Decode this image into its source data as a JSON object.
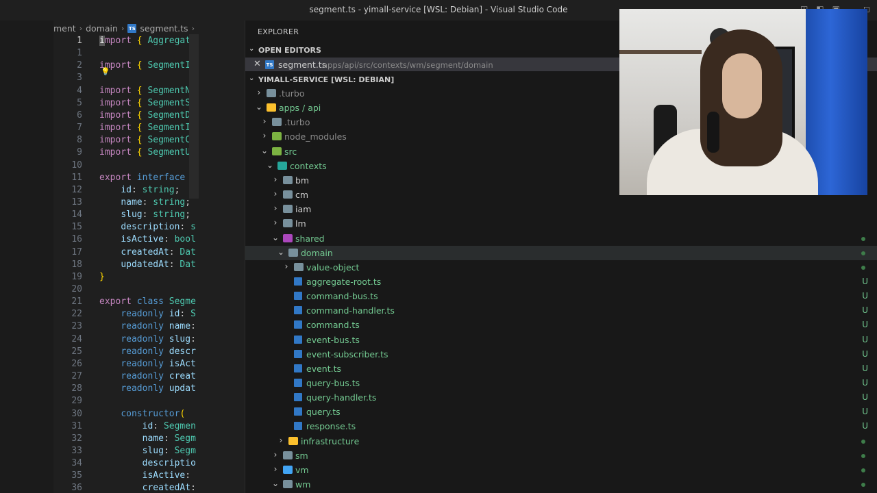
{
  "window": {
    "title": "segment.ts - yimall-service [WSL: Debian] - Visual Studio Code"
  },
  "editor": {
    "breadcrumb": [
      "ment",
      "domain",
      "segment.ts",
      "..."
    ],
    "lines": [
      {
        "n": "1",
        "tokens": [
          [
            "cursor",
            "i"
          ],
          [
            "kw",
            "mport "
          ],
          [
            "br",
            "{ "
          ],
          [
            "ty",
            "Aggregate"
          ]
        ]
      },
      {
        "n": "1",
        "tokens": []
      },
      {
        "n": "2",
        "tokens": [
          [
            "kw",
            "import "
          ],
          [
            "br",
            "{ "
          ],
          [
            "ty",
            "SegmentId"
          ]
        ]
      },
      {
        "n": "3",
        "tokens": []
      },
      {
        "n": "4",
        "tokens": [
          [
            "kw",
            "import "
          ],
          [
            "br",
            "{ "
          ],
          [
            "ty",
            "SegmentNa"
          ]
        ]
      },
      {
        "n": "5",
        "tokens": [
          [
            "kw",
            "import "
          ],
          [
            "br",
            "{ "
          ],
          [
            "ty",
            "SegmentSl"
          ]
        ]
      },
      {
        "n": "6",
        "tokens": [
          [
            "kw",
            "import "
          ],
          [
            "br",
            "{ "
          ],
          [
            "ty",
            "SegmentDe"
          ]
        ]
      },
      {
        "n": "7",
        "tokens": [
          [
            "kw",
            "import "
          ],
          [
            "br",
            "{ "
          ],
          [
            "ty",
            "SegmentIs"
          ]
        ]
      },
      {
        "n": "8",
        "tokens": [
          [
            "kw",
            "import "
          ],
          [
            "br",
            "{ "
          ],
          [
            "ty",
            "SegmentCr"
          ]
        ]
      },
      {
        "n": "9",
        "tokens": [
          [
            "kw",
            "import "
          ],
          [
            "br",
            "{ "
          ],
          [
            "ty",
            "SegmentUp"
          ]
        ]
      },
      {
        "n": "10",
        "tokens": []
      },
      {
        "n": "11",
        "tokens": [
          [
            "kw",
            "export "
          ],
          [
            "kw2",
            "interface "
          ],
          [
            "ty",
            "S"
          ]
        ]
      },
      {
        "n": "12",
        "tokens": [
          [
            "pun",
            "    "
          ],
          [
            "prop",
            "id"
          ],
          [
            "pun",
            ": "
          ],
          [
            "ty",
            "string"
          ],
          [
            "pun",
            ";"
          ]
        ]
      },
      {
        "n": "13",
        "tokens": [
          [
            "pun",
            "    "
          ],
          [
            "prop",
            "name"
          ],
          [
            "pun",
            ": "
          ],
          [
            "ty",
            "string"
          ],
          [
            "pun",
            ";"
          ]
        ]
      },
      {
        "n": "14",
        "tokens": [
          [
            "pun",
            "    "
          ],
          [
            "prop",
            "slug"
          ],
          [
            "pun",
            ": "
          ],
          [
            "ty",
            "string"
          ],
          [
            "pun",
            ";"
          ]
        ]
      },
      {
        "n": "15",
        "tokens": [
          [
            "pun",
            "    "
          ],
          [
            "prop",
            "description"
          ],
          [
            "pun",
            ": "
          ],
          [
            "ty",
            "s"
          ]
        ]
      },
      {
        "n": "16",
        "tokens": [
          [
            "pun",
            "    "
          ],
          [
            "prop",
            "isActive"
          ],
          [
            "pun",
            ": "
          ],
          [
            "ty",
            "bool"
          ]
        ]
      },
      {
        "n": "17",
        "tokens": [
          [
            "pun",
            "    "
          ],
          [
            "prop",
            "createdAt"
          ],
          [
            "pun",
            ": "
          ],
          [
            "ty",
            "Dat"
          ]
        ]
      },
      {
        "n": "18",
        "tokens": [
          [
            "pun",
            "    "
          ],
          [
            "prop",
            "updatedAt"
          ],
          [
            "pun",
            ": "
          ],
          [
            "ty",
            "Dat"
          ]
        ]
      },
      {
        "n": "19",
        "tokens": [
          [
            "br",
            "}"
          ]
        ]
      },
      {
        "n": "20",
        "tokens": []
      },
      {
        "n": "21",
        "tokens": [
          [
            "kw",
            "export "
          ],
          [
            "kw2",
            "class "
          ],
          [
            "ty",
            "Segme"
          ]
        ]
      },
      {
        "n": "22",
        "tokens": [
          [
            "pun",
            "    "
          ],
          [
            "kw2",
            "readonly "
          ],
          [
            "prop",
            "id"
          ],
          [
            "pun",
            ": "
          ],
          [
            "ty",
            "S"
          ]
        ]
      },
      {
        "n": "23",
        "tokens": [
          [
            "pun",
            "    "
          ],
          [
            "kw2",
            "readonly "
          ],
          [
            "prop",
            "name"
          ],
          [
            "pun",
            ":"
          ]
        ]
      },
      {
        "n": "24",
        "tokens": [
          [
            "pun",
            "    "
          ],
          [
            "kw2",
            "readonly "
          ],
          [
            "prop",
            "slug"
          ],
          [
            "pun",
            ":"
          ]
        ]
      },
      {
        "n": "25",
        "tokens": [
          [
            "pun",
            "    "
          ],
          [
            "kw2",
            "readonly "
          ],
          [
            "prop",
            "descr"
          ]
        ]
      },
      {
        "n": "26",
        "tokens": [
          [
            "pun",
            "    "
          ],
          [
            "kw2",
            "readonly "
          ],
          [
            "prop",
            "isAct"
          ]
        ]
      },
      {
        "n": "27",
        "tokens": [
          [
            "pun",
            "    "
          ],
          [
            "kw2",
            "readonly "
          ],
          [
            "prop",
            "creat"
          ]
        ]
      },
      {
        "n": "28",
        "tokens": [
          [
            "pun",
            "    "
          ],
          [
            "kw2",
            "readonly "
          ],
          [
            "prop",
            "updat"
          ]
        ]
      },
      {
        "n": "29",
        "tokens": []
      },
      {
        "n": "30",
        "tokens": [
          [
            "pun",
            "    "
          ],
          [
            "kw2",
            "constructor"
          ],
          [
            "br",
            "("
          ]
        ]
      },
      {
        "n": "31",
        "tokens": [
          [
            "pun",
            "        "
          ],
          [
            "prop",
            "id"
          ],
          [
            "pun",
            ": "
          ],
          [
            "ty",
            "Segmen"
          ]
        ]
      },
      {
        "n": "32",
        "tokens": [
          [
            "pun",
            "        "
          ],
          [
            "prop",
            "name"
          ],
          [
            "pun",
            ": "
          ],
          [
            "ty",
            "Segm"
          ]
        ]
      },
      {
        "n": "33",
        "tokens": [
          [
            "pun",
            "        "
          ],
          [
            "prop",
            "slug"
          ],
          [
            "pun",
            ": "
          ],
          [
            "ty",
            "Segm"
          ]
        ]
      },
      {
        "n": "34",
        "tokens": [
          [
            "pun",
            "        "
          ],
          [
            "prop",
            "descriptio"
          ]
        ]
      },
      {
        "n": "35",
        "tokens": [
          [
            "pun",
            "        "
          ],
          [
            "prop",
            "isActive"
          ],
          [
            "pun",
            ":"
          ]
        ]
      },
      {
        "n": "36",
        "tokens": [
          [
            "pun",
            "        "
          ],
          [
            "prop",
            "createdAt"
          ],
          [
            "pun",
            ":"
          ]
        ]
      }
    ]
  },
  "explorer": {
    "title": "EXPLORER",
    "open_editors_label": "OPEN EDITORS",
    "open_editor": {
      "name": "segment.ts",
      "path": "apps/api/src/contexts/wm/segment/domain"
    },
    "workspace_label": "YIMALL-SERVICE [WSL: DEBIAN]",
    "tree": [
      {
        "depth": 0,
        "type": "folder",
        "open": false,
        "name": ".turbo",
        "color": "gray2",
        "name_color": "#8b8b8b",
        "status": "",
        "dot": false
      },
      {
        "depth": 0,
        "type": "folder",
        "open": true,
        "name": "apps / api",
        "color": "yellow",
        "name_color": "#73c991",
        "status": "",
        "dot": true
      },
      {
        "depth": 1,
        "type": "folder",
        "open": false,
        "name": ".turbo",
        "color": "gray2",
        "name_color": "#8b8b8b",
        "status": "",
        "dot": false
      },
      {
        "depth": 1,
        "type": "folder",
        "open": false,
        "name": "node_modules",
        "color": "green",
        "name_color": "#8b8b8b",
        "status": "",
        "dot": false
      },
      {
        "depth": 1,
        "type": "folder",
        "open": true,
        "name": "src",
        "color": "green",
        "name_color": "#73c991",
        "status": "",
        "dot": true
      },
      {
        "depth": 2,
        "type": "folder",
        "open": true,
        "name": "contexts",
        "color": "teal",
        "name_color": "#73c991",
        "status": "",
        "dot": true
      },
      {
        "depth": 3,
        "type": "folder",
        "open": false,
        "name": "bm",
        "color": "gray2",
        "name_color": "#cccccc",
        "status": "",
        "dot": false
      },
      {
        "depth": 3,
        "type": "folder",
        "open": false,
        "name": "cm",
        "color": "gray2",
        "name_color": "#cccccc",
        "status": "",
        "dot": false
      },
      {
        "depth": 3,
        "type": "folder",
        "open": false,
        "name": "iam",
        "color": "gray2",
        "name_color": "#cccccc",
        "status": "",
        "dot": false
      },
      {
        "depth": 3,
        "type": "folder",
        "open": false,
        "name": "lm",
        "color": "gray2",
        "name_color": "#cccccc",
        "status": "",
        "dot": false
      },
      {
        "depth": 3,
        "type": "folder",
        "open": true,
        "name": "shared",
        "color": "purple",
        "name_color": "#73c991",
        "status": "",
        "dot": true
      },
      {
        "depth": 4,
        "type": "folder",
        "open": true,
        "name": "domain",
        "color": "gray2",
        "name_color": "#73c991",
        "status": "",
        "dot": true,
        "selected": true
      },
      {
        "depth": 5,
        "type": "folder",
        "open": false,
        "name": "value-object",
        "color": "gray2",
        "name_color": "#73c991",
        "status": "",
        "dot": true
      },
      {
        "depth": 5,
        "type": "file",
        "name": "aggregate-root.ts",
        "name_color": "#73c991",
        "status": "U",
        "dot": false
      },
      {
        "depth": 5,
        "type": "file",
        "name": "command-bus.ts",
        "name_color": "#73c991",
        "status": "U",
        "dot": false
      },
      {
        "depth": 5,
        "type": "file",
        "name": "command-handler.ts",
        "name_color": "#73c991",
        "status": "U",
        "dot": false
      },
      {
        "depth": 5,
        "type": "file",
        "name": "command.ts",
        "name_color": "#73c991",
        "status": "U",
        "dot": false
      },
      {
        "depth": 5,
        "type": "file",
        "name": "event-bus.ts",
        "name_color": "#73c991",
        "status": "U",
        "dot": false
      },
      {
        "depth": 5,
        "type": "file",
        "name": "event-subscriber.ts",
        "name_color": "#73c991",
        "status": "U",
        "dot": false
      },
      {
        "depth": 5,
        "type": "file",
        "name": "event.ts",
        "name_color": "#73c991",
        "status": "U",
        "dot": false
      },
      {
        "depth": 5,
        "type": "file",
        "name": "query-bus.ts",
        "name_color": "#73c991",
        "status": "U",
        "dot": false
      },
      {
        "depth": 5,
        "type": "file",
        "name": "query-handler.ts",
        "name_color": "#73c991",
        "status": "U",
        "dot": false
      },
      {
        "depth": 5,
        "type": "file",
        "name": "query.ts",
        "name_color": "#73c991",
        "status": "U",
        "dot": false
      },
      {
        "depth": 5,
        "type": "file",
        "name": "response.ts",
        "name_color": "#73c991",
        "status": "U",
        "dot": false
      },
      {
        "depth": 4,
        "type": "folder",
        "open": false,
        "name": "infrastructure",
        "color": "yellow",
        "name_color": "#73c991",
        "status": "",
        "dot": true
      },
      {
        "depth": 3,
        "type": "folder",
        "open": false,
        "name": "sm",
        "color": "gray2",
        "name_color": "#73c991",
        "status": "",
        "dot": true
      },
      {
        "depth": 3,
        "type": "folder",
        "open": false,
        "name": "vm",
        "color": "blue",
        "name_color": "#73c991",
        "status": "",
        "dot": true
      },
      {
        "depth": 3,
        "type": "folder",
        "open": true,
        "name": "wm",
        "color": "gray2",
        "name_color": "#73c991",
        "status": "",
        "dot": true
      }
    ]
  },
  "colors": {
    "untracked": "#73c991",
    "accent": "#007acc",
    "ts_icon": "#3178c6"
  }
}
